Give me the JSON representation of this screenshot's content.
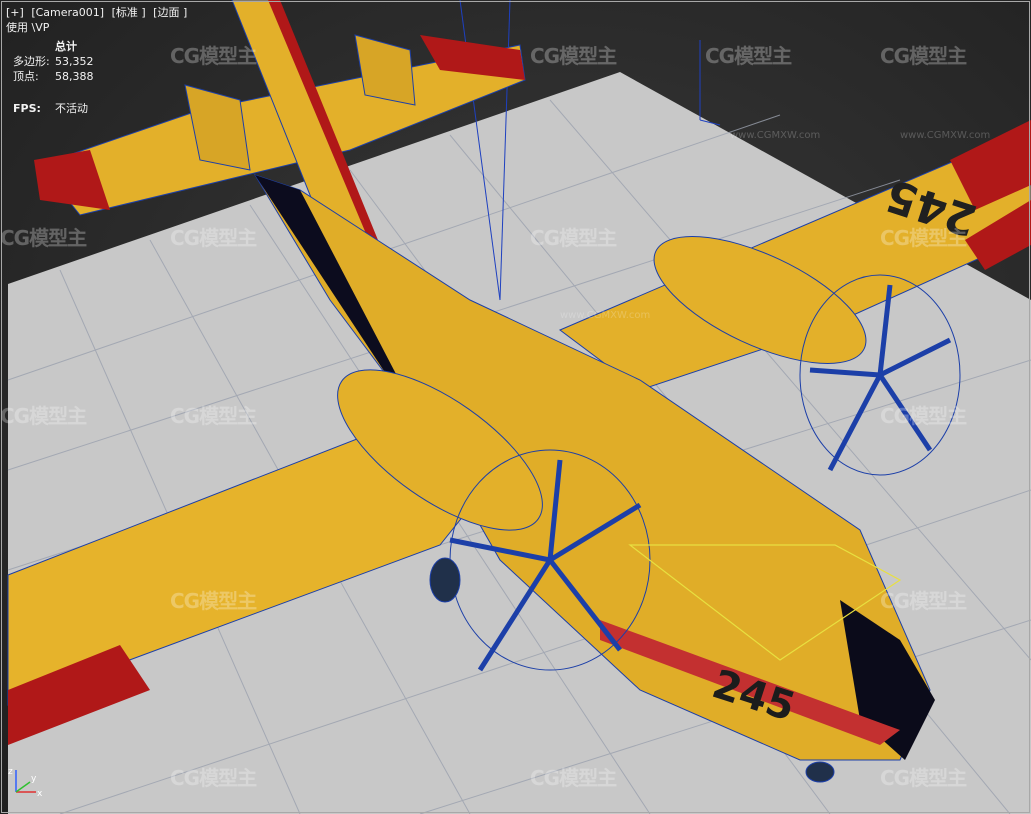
{
  "viewport_label": {
    "plus": "[+]",
    "camera": "[Camera001]",
    "shading": "[标准 ]",
    "edges": "[边面 ]"
  },
  "viewport_sub": "使用 \\VP",
  "stats": {
    "header": "总计",
    "polygons_label": "多边形:",
    "polygons_value": "53,352",
    "vertices_label": "顶点:",
    "vertices_value": "58,388"
  },
  "fps": {
    "label": "FPS:",
    "value": "不活动"
  },
  "aircraft_marking": "245",
  "watermark": {
    "brand": "CG模型主",
    "url": "www.CGMXW.com"
  },
  "axes": {
    "x": "x",
    "y": "y",
    "z": "z"
  },
  "colors": {
    "body_yellow": "#e8b62a",
    "stripe_red": "#b01818",
    "wire_blue": "#1c3fa8",
    "ground": "#c9c9c9",
    "grid": "#9aa0ad",
    "selection": "#e8e040"
  }
}
